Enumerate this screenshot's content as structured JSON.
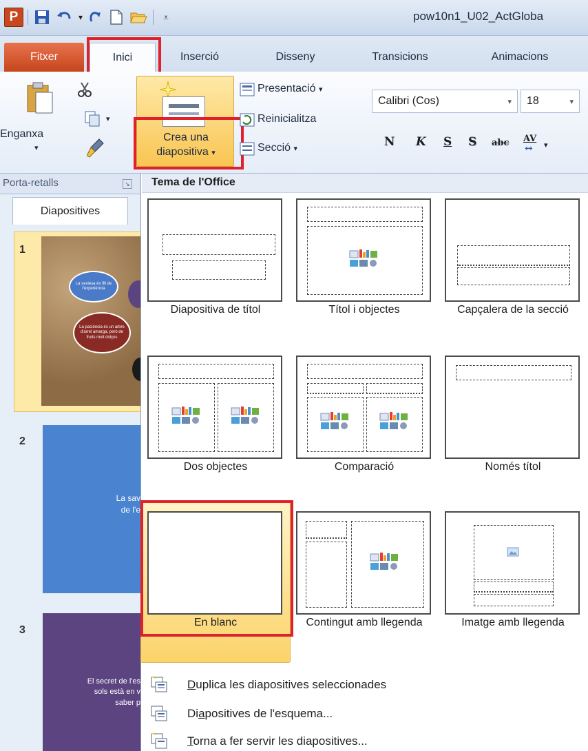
{
  "window": {
    "title": "pow10n1_U02_ActGloba"
  },
  "tabs": [
    "Fitxer",
    "Inici",
    "Inserció",
    "Disseny",
    "Transicions",
    "Animacions"
  ],
  "clipboard": {
    "paste_label": "Enganxa",
    "group_label": "Porta-retalls"
  },
  "slides_group": {
    "new_slide_line1": "Crea una",
    "new_slide_line2": "diapositiva",
    "layout_label": "Presentació",
    "reset_label": "Reinicialitza",
    "section_label": "Secció"
  },
  "font": {
    "name": "Calibri (Cos)",
    "size": "18",
    "bold": "N",
    "italic": "K",
    "underline": "S",
    "shadow": "S",
    "strike": "abc",
    "spacing": "AV"
  },
  "panel": {
    "tab_label": "Diapositives"
  },
  "slides": [
    {
      "number": "1",
      "bubbles": [
        "La saviesa és fill de l'experiència",
        "La paciència és un arbre d'arrel amarga, però de fruits molt dolços"
      ]
    },
    {
      "number": "2",
      "text_line1": "La sav",
      "text_line2": "de l'e"
    },
    {
      "number": "3",
      "text_line1": "El secret de l'es",
      "text_line2": "sols està en v",
      "text_line3": "saber p"
    }
  ],
  "gallery": {
    "title": "Tema de l'Office",
    "layouts": [
      "Diapositiva de títol",
      "Títol i objectes",
      "Capçalera de la secció",
      "Dos objectes",
      "Comparació",
      "Només títol",
      "En blanc",
      "Contingut amb llegenda",
      "Imatge amb llegenda"
    ]
  },
  "menu": [
    {
      "prefix": "",
      "accel": "D",
      "rest": "uplica les diapositives seleccionades"
    },
    {
      "prefix": "Di",
      "accel": "a",
      "rest": "positives de l'esquema..."
    },
    {
      "prefix": "",
      "accel": "T",
      "rest": "orna a fer servir les diapositives..."
    }
  ],
  "colors": {
    "highlight": "#e0202a",
    "file_tab": "#d0552c",
    "selected_bg": "#fbd36a"
  }
}
